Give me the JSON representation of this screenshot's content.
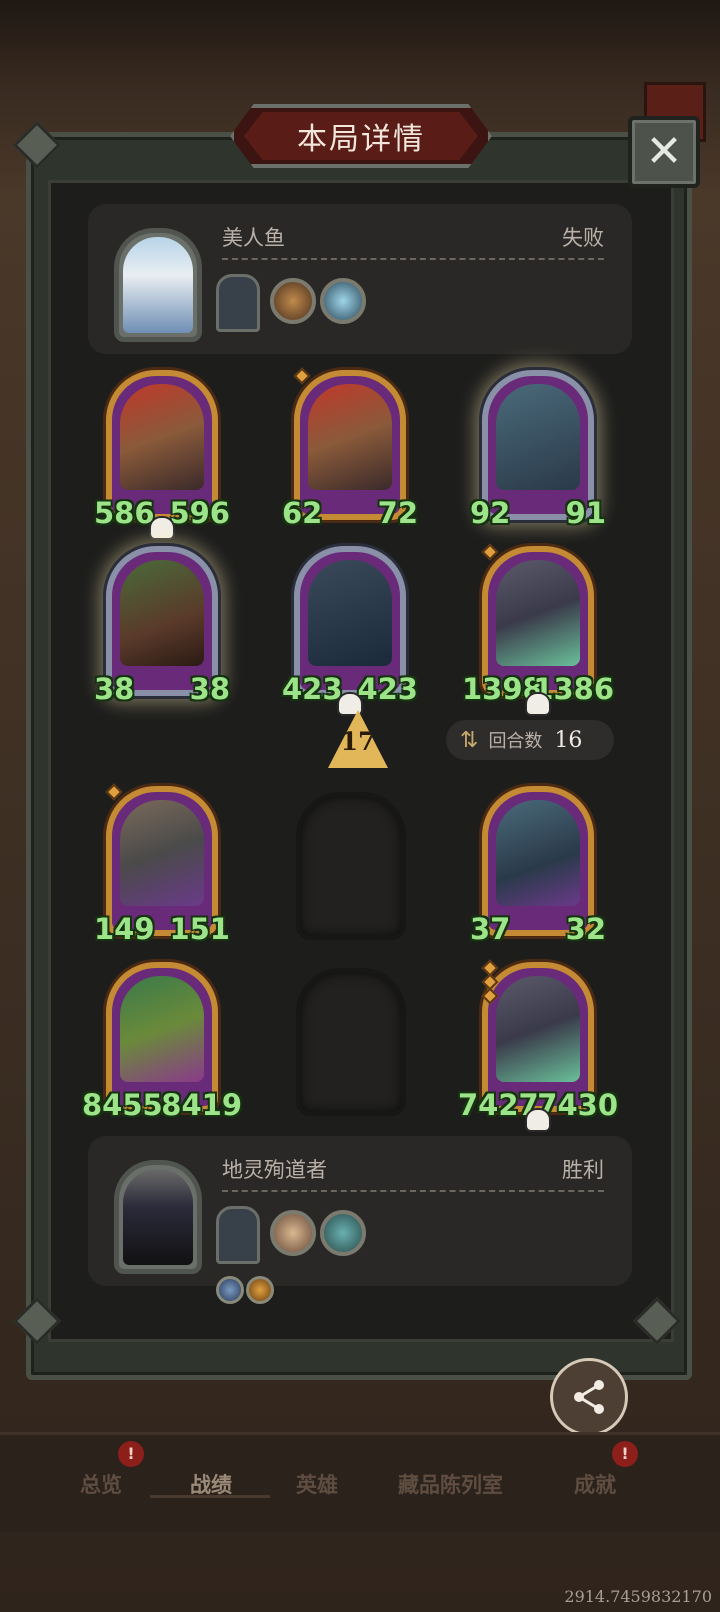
{
  "title": "本局详情",
  "close_icon": "close-icon",
  "opponent": {
    "name": "美人鱼",
    "result": "失败",
    "portrait_icon": "mermaid-portrait",
    "items": [
      "hero-card",
      "golden-relic",
      "frozen-relic"
    ]
  },
  "board": [
    {
      "slot": "r1c1",
      "icon": "mech-tank",
      "attack": "586",
      "health": "596",
      "dead": true,
      "frame": "gold"
    },
    {
      "slot": "r1c2",
      "icon": "mech-tank",
      "attack": "62",
      "health": "72",
      "dead": false,
      "frame": "gold"
    },
    {
      "slot": "r1c3",
      "icon": "robot-thinker",
      "attack": "92",
      "health": "91",
      "dead": false,
      "frame": "silver"
    },
    {
      "slot": "r2c1",
      "icon": "boar",
      "attack": "38",
      "health": "38",
      "dead": false,
      "frame": "silver"
    },
    {
      "slot": "r2c2",
      "icon": "iron-knight",
      "attack": "423",
      "health": "423",
      "dead": true,
      "frame": "silver"
    },
    {
      "slot": "r2c3",
      "icon": "dragon-roar",
      "attack": "1398",
      "health": "1386",
      "dead": true,
      "frame": "gold"
    },
    {
      "slot": "r3c1",
      "icon": "windmill",
      "attack": "149",
      "health": "151",
      "dead": false,
      "frame": "gold"
    },
    {
      "slot": "r3c3",
      "icon": "robot-thinker",
      "attack": "37",
      "health": "32",
      "dead": false,
      "frame": "gold"
    },
    {
      "slot": "r4c1",
      "icon": "fairy",
      "attack": "8455",
      "health": "8419",
      "dead": false,
      "frame": "gold"
    },
    {
      "slot": "r4c3",
      "icon": "dragon-roar",
      "attack": "7427",
      "health": "7430",
      "dead": true,
      "frame": "gold"
    }
  ],
  "tier": "17",
  "round": {
    "label": "回合数",
    "value": "16",
    "icon": "swap-icon"
  },
  "self": {
    "name": "地灵殉道者",
    "result": "胜利",
    "portrait_icon": "hooded-figure-portrait",
    "items": [
      "hero-card",
      "coin-relic",
      "egg-relic"
    ],
    "buffs": [
      "swords-buff",
      "coin-buff"
    ]
  },
  "tabs": [
    {
      "label": "总览",
      "badge": "!"
    },
    {
      "label": "战绩",
      "badge": ""
    },
    {
      "label": "英雄",
      "badge": ""
    },
    {
      "label": "藏品陈列室",
      "badge": ""
    },
    {
      "label": "成就",
      "badge": "!"
    }
  ],
  "share_label": "分享",
  "uid": "2914.7459832170",
  "colors": {
    "stat_green": "#9de38a",
    "gold_frame": "#c48a34",
    "silver_frame": "#8990a8",
    "title_red": "#5a1c17"
  }
}
